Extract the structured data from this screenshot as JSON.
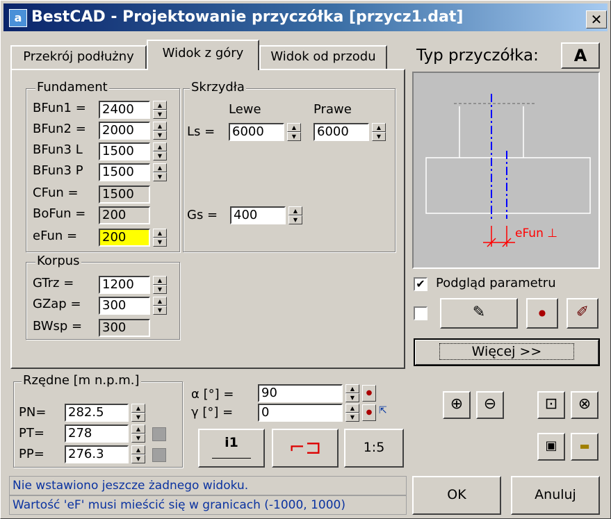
{
  "window": {
    "title": "BestCAD - Projektowanie przyczółka [przycz1.dat]",
    "icon": "app-icon",
    "close_label": "x"
  },
  "tabs": [
    {
      "label": "Przekrój podłużny",
      "selected": false
    },
    {
      "label": "Widok z góry",
      "selected": true
    },
    {
      "label": "Widok od przodu",
      "selected": false
    }
  ],
  "fundament": {
    "title": "Fundament",
    "rows": [
      {
        "label": "BFun1 =",
        "value": "2400"
      },
      {
        "label": "BFun2 =",
        "value": "2000"
      },
      {
        "label": "BFun3 L",
        "value": "1500"
      },
      {
        "label": "BFun3 P",
        "value": "1500"
      },
      {
        "label": "CFun =",
        "value": "1500"
      },
      {
        "label": "BoFun =",
        "value": "200"
      },
      {
        "label": "eFun =",
        "value": "200"
      }
    ]
  },
  "skrzydla": {
    "title": "Skrzydła",
    "col_left": "Lewe",
    "col_right": "Prawe",
    "ls_label": "Ls =",
    "ls_left": "6000",
    "ls_right": "6000",
    "gs_label": "Gs =",
    "gs_value": "400"
  },
  "korpus": {
    "title": "Korpus",
    "rows": [
      {
        "label": "GTrz =",
        "value": "1200"
      },
      {
        "label": "GZap =",
        "value": "300"
      },
      {
        "label": "BWsp =",
        "value": "300"
      }
    ]
  },
  "typ": {
    "label": "Typ przyczółka:",
    "value": "A",
    "preview_label": "eFun ⊥"
  },
  "podglad": {
    "label": "Podgląd parametru",
    "checked": true
  },
  "wiecej_label": "Więcej >>",
  "rzedne": {
    "title": "Rzędne [m n.p.m.]",
    "rows": [
      {
        "label": "PN=",
        "value": "282.5"
      },
      {
        "label": "PT=",
        "value": "278"
      },
      {
        "label": "PP=",
        "value": "276.3"
      }
    ]
  },
  "angles": {
    "alpha_label": "α  [°] =",
    "alpha_value": "90",
    "gamma_label": "γ  [°] =",
    "gamma_value": "0"
  },
  "buttons": {
    "i1": "i1",
    "scale": "1:5",
    "ok": "OK",
    "cancel": "Anuluj"
  },
  "status": {
    "line1": "Nie wstawiono jeszcze żadnego widoku.",
    "line2": "Wartość 'eF' musi mieścić się w granicach (-1000, 1000)"
  },
  "colors": {
    "title_bar": "#0a246a",
    "highlight_field": "#ffff00",
    "status_text": "#0a32a0",
    "preview_bg": "#c0c0c0",
    "axis_blue": "#0000ff",
    "dim_red": "#ff0000"
  }
}
